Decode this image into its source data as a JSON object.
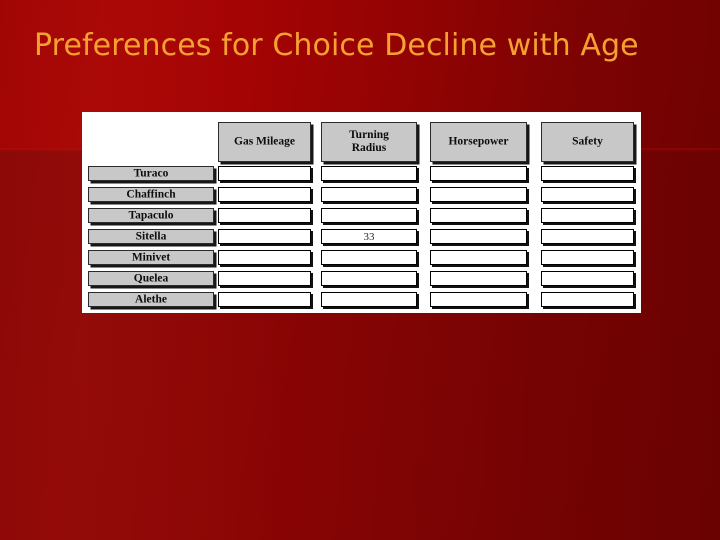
{
  "slide": {
    "title": "Preferences for Choice Decline with Age",
    "title_color": "#f5a132",
    "background_color": "#8d0505"
  },
  "table": {
    "corner_label": "",
    "columns": [
      {
        "id": "gas-mileage",
        "label": "Gas Mileage",
        "lines": [
          "Gas Mileage"
        ]
      },
      {
        "id": "turning-radius",
        "label": "Turning Radius",
        "lines": [
          "Turning",
          "Radius"
        ]
      },
      {
        "id": "horsepower",
        "label": "Horsepower",
        "lines": [
          "Horsepower"
        ]
      },
      {
        "id": "safety",
        "label": "Safety",
        "lines": [
          "Safety"
        ]
      }
    ],
    "rows": [
      {
        "id": "turaco",
        "label": "Turaco",
        "cells": [
          "",
          "",
          "",
          ""
        ]
      },
      {
        "id": "chaffinch",
        "label": "Chaffinch",
        "cells": [
          "",
          "",
          "",
          ""
        ]
      },
      {
        "id": "tapaculo",
        "label": "Tapaculo",
        "cells": [
          "",
          "",
          "",
          ""
        ]
      },
      {
        "id": "sitella",
        "label": "Sitella",
        "cells": [
          "",
          "33",
          "",
          ""
        ]
      },
      {
        "id": "minivet",
        "label": "Minivet",
        "cells": [
          "",
          "",
          "",
          ""
        ]
      },
      {
        "id": "quelea",
        "label": "Quelea",
        "cells": [
          "",
          "",
          "",
          ""
        ]
      },
      {
        "id": "alethe",
        "label": "Alethe",
        "cells": [
          "",
          "",
          "",
          ""
        ]
      }
    ]
  }
}
